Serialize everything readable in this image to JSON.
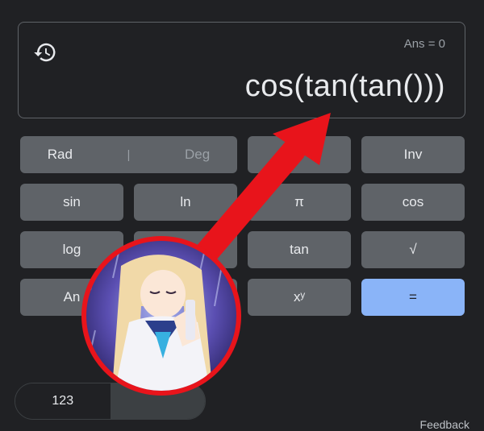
{
  "display": {
    "ans": "Ans = 0",
    "expression": "cos(tan(tan()))"
  },
  "keys": {
    "rad": "Rad",
    "deg": "Deg",
    "sep": "|",
    "inv": "Inv",
    "sin": "sin",
    "ln": "ln",
    "pi": "π",
    "cos": "cos",
    "log": "log",
    "tan": "tan",
    "sqrt": "√",
    "ans_partial": "An",
    "power": "xʸ",
    "equals": "="
  },
  "bottom": {
    "numpad_toggle": "123",
    "feedback": "Feedback"
  },
  "colors": {
    "background": "#202124",
    "key": "#5f6368",
    "equals": "#8ab4f8",
    "arrow": "#e8141b"
  },
  "icons": [
    "history-icon",
    "red-arrow",
    "anime-avatar"
  ]
}
